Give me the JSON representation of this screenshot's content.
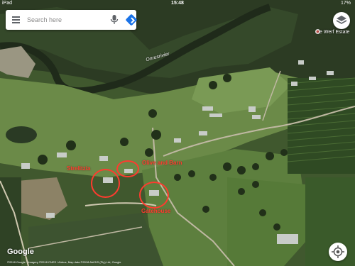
{
  "status_bar": {
    "carrier": "iPad",
    "time": "15:48",
    "battery": "17%"
  },
  "search": {
    "placeholder": "Search here"
  },
  "map": {
    "poi_label": "De Werf Estate",
    "river_label": "Onrusrivier",
    "logo": "Google",
    "attribution": "©2018 Google · Imagery ©2018 CNES / Airbus, Map data ©2018 AfriGIS (Pty) Ltd, Google"
  },
  "annotations": [
    {
      "label": "Strelitzia"
    },
    {
      "label": "Olive and Barn"
    },
    {
      "label": "Gatehouse"
    }
  ],
  "icons": {
    "menu": "hamburger-menu-icon",
    "mic": "microphone-icon",
    "directions": "directions-icon",
    "layers": "layers-icon",
    "location": "my-location-icon"
  },
  "colors": {
    "annotation": "#ff3b2f",
    "directions": "#1a73e8"
  }
}
